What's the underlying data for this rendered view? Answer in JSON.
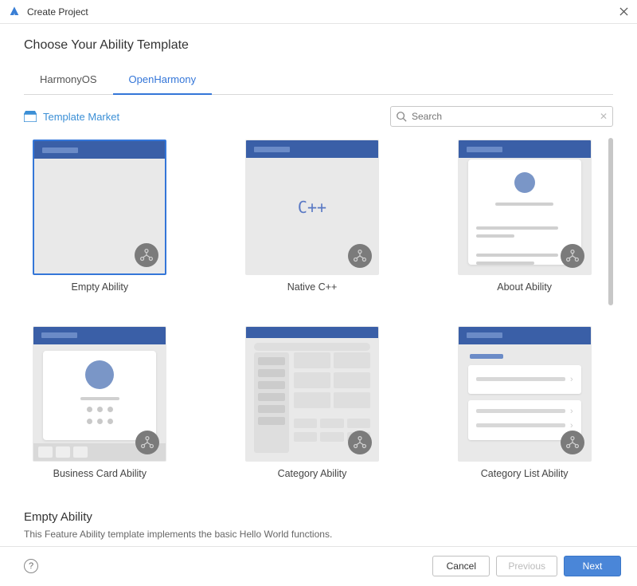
{
  "window": {
    "title": "Create Project"
  },
  "page": {
    "title": "Choose Your Ability Template"
  },
  "tabs": {
    "harmonyos": "HarmonyOS",
    "openharmony": "OpenHarmony"
  },
  "market": {
    "label": "Template Market"
  },
  "search": {
    "placeholder": "Search"
  },
  "templates": {
    "empty_ability": "Empty Ability",
    "native_cpp": "Native C++",
    "about_ability": "About Ability",
    "business_card": "Business Card Ability",
    "category_ability": "Category Ability",
    "category_list": "Category List Ability",
    "cpp_glyph": "C++"
  },
  "description": {
    "title": "Empty Ability",
    "text": "This Feature Ability template implements the basic Hello World functions."
  },
  "footer": {
    "help": "?",
    "cancel": "Cancel",
    "previous": "Previous",
    "next": "Next"
  },
  "colors": {
    "accent": "#3476d8",
    "header_blue": "#3a5fa7"
  }
}
